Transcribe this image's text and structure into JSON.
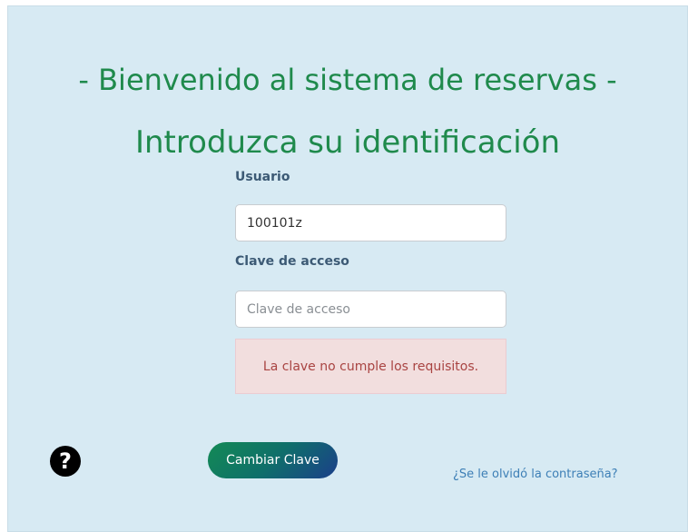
{
  "header": {
    "title": "- Bienvenido al sistema de reservas -",
    "subtitle": "Introduzca su identificación"
  },
  "form": {
    "user_label": "Usuario",
    "user_value": "100101z",
    "password_label": "Clave de acceso",
    "password_placeholder": "Clave de acceso",
    "password_value": "",
    "error_message": "La clave no cumple los requisitos."
  },
  "actions": {
    "help_icon": "question-circle-icon",
    "help_glyph": "?",
    "change_password_label": "Cambiar Clave",
    "forgot_password_link": "¿Se le olvidó la contraseña?"
  },
  "colors": {
    "panel_background": "#d7eaf3",
    "title": "#1f8a4c",
    "label": "#3c5a75",
    "alert_background": "#f2dede",
    "alert_text": "#a94442",
    "link": "#3d7fb6"
  }
}
